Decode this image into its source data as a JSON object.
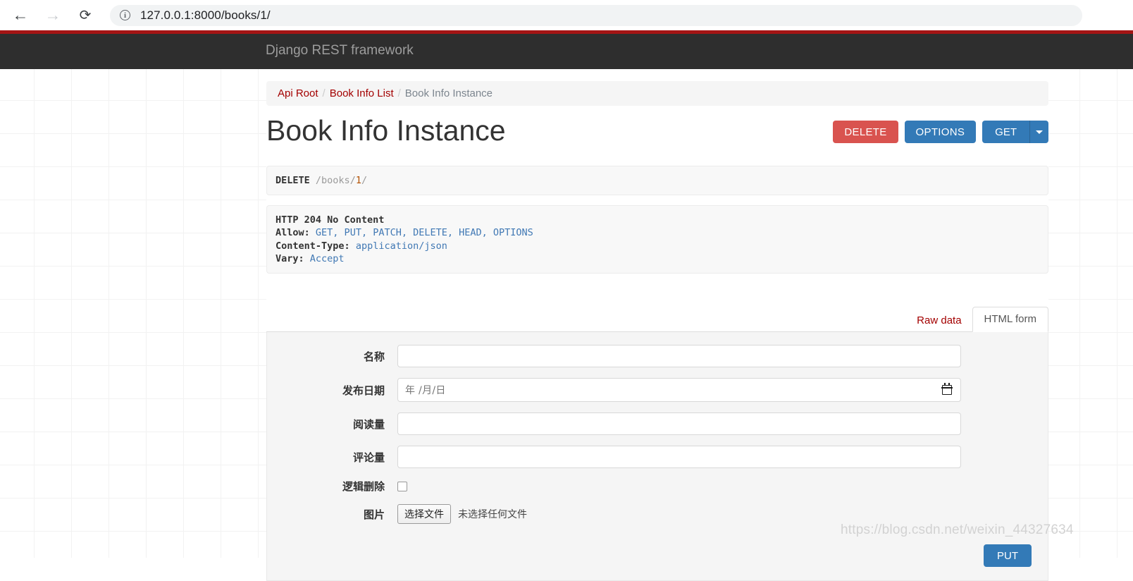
{
  "browser": {
    "back_icon": "arrow-left-icon",
    "forward_icon": "arrow-right-icon",
    "reload_icon": "reload-icon",
    "site_info_icon": "info-circle-icon",
    "url": "127.0.0.1:8000/books/1/"
  },
  "navbar": {
    "brand": "Django REST framework",
    "accent_color": "#a41515",
    "background_color": "#2e2e2e"
  },
  "breadcrumb": {
    "items": [
      {
        "label": "Api Root",
        "link": true
      },
      {
        "label": "Book Info List",
        "link": true
      },
      {
        "label": "Book Info Instance",
        "link": false
      }
    ],
    "separator": "/"
  },
  "header": {
    "title": "Book Info Instance",
    "buttons": {
      "delete": "DELETE",
      "options": "OPTIONS",
      "get": "GET",
      "caret_icon": "chevron-down-icon"
    }
  },
  "request": {
    "method": "DELETE",
    "path": "/books/",
    "id": "1",
    "trailing": "/"
  },
  "response": {
    "status_line": "HTTP 204 No Content",
    "headers": [
      {
        "name": "Allow:",
        "value": "GET, PUT, PATCH, DELETE, HEAD, OPTIONS"
      },
      {
        "name": "Content-Type:",
        "value": "application/json"
      },
      {
        "name": "Vary:",
        "value": "Accept"
      }
    ]
  },
  "tabs": {
    "raw_data": "Raw data",
    "html_form": "HTML form",
    "active": "HTML form"
  },
  "form": {
    "fields": [
      {
        "label": "名称",
        "type": "text",
        "value": "",
        "placeholder": ""
      },
      {
        "label": "发布日期",
        "type": "date",
        "value": "",
        "placeholder": "年 /月/日"
      },
      {
        "label": "阅读量",
        "type": "text",
        "value": "",
        "placeholder": ""
      },
      {
        "label": "评论量",
        "type": "text",
        "value": "",
        "placeholder": ""
      },
      {
        "label": "逻辑删除",
        "type": "checkbox",
        "checked": false
      },
      {
        "label": "图片",
        "type": "file",
        "button": "选择文件",
        "status": "未选择任何文件"
      }
    ],
    "submit_label": "PUT"
  },
  "watermark": "https://blog.csdn.net/weixin_44327634"
}
